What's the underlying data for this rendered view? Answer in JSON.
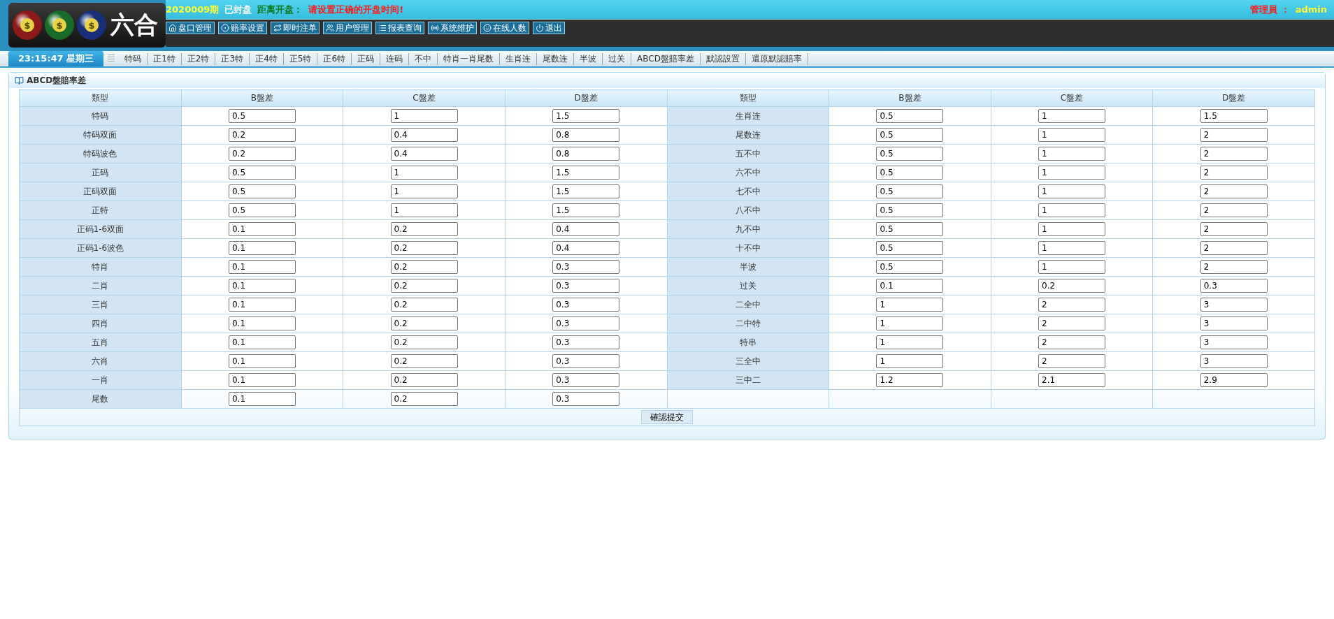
{
  "logo": {
    "balls": [
      {
        "color": "#8b1a1a",
        "symbol": "$"
      },
      {
        "color": "#1a6b2a",
        "symbol": "$"
      },
      {
        "color": "#1a2f7a",
        "symbol": "$"
      }
    ],
    "title": "六合"
  },
  "status": {
    "period": "2020009期",
    "state": "已封盘",
    "countdown_label": "距离开盘：",
    "countdown_value": "请设置正确的开盘时间!",
    "user_label": "管理員 ：",
    "user": "admin"
  },
  "nav": [
    {
      "kind": "home",
      "label": "盘口管理"
    },
    {
      "kind": "target",
      "label": "赔率设置"
    },
    {
      "kind": "repeat",
      "label": "即时注单"
    },
    {
      "kind": "users",
      "label": "用户管理"
    },
    {
      "kind": "list",
      "label": "报表查询"
    },
    {
      "kind": "signal",
      "label": "系统维护"
    },
    {
      "kind": "smile",
      "label": "在线人数"
    },
    {
      "kind": "power",
      "label": "退出"
    }
  ],
  "clock": "23:15:47 星期三",
  "tabs": [
    "特码",
    "正1特",
    "正2特",
    "正3特",
    "正4特",
    "正5特",
    "正6特",
    "正码",
    "连码",
    "不中",
    "特肖一肖尾数",
    "生肖连",
    "尾数连",
    "半波",
    "过关",
    "ABCD盤賠率差",
    "默認設置",
    "還原默認賠率"
  ],
  "panel": {
    "title": "ABCD盤賠率差",
    "columns": [
      "類型",
      "B盤差",
      "C盤差",
      "D盤差",
      "類型",
      "B盤差",
      "C盤差",
      "D盤差"
    ],
    "rows": [
      {
        "left": {
          "type": "特码",
          "b": "0.5",
          "c": "1",
          "d": "1.5"
        },
        "right": {
          "type": "生肖连",
          "b": "0.5",
          "c": "1",
          "d": "1.5"
        }
      },
      {
        "left": {
          "type": "特码双面",
          "b": "0.2",
          "c": "0.4",
          "d": "0.8"
        },
        "right": {
          "type": "尾数连",
          "b": "0.5",
          "c": "1",
          "d": "2"
        }
      },
      {
        "left": {
          "type": "特码波色",
          "b": "0.2",
          "c": "0.4",
          "d": "0.8"
        },
        "right": {
          "type": "五不中",
          "b": "0.5",
          "c": "1",
          "d": "2"
        }
      },
      {
        "left": {
          "type": "正码",
          "b": "0.5",
          "c": "1",
          "d": "1.5"
        },
        "right": {
          "type": "六不中",
          "b": "0.5",
          "c": "1",
          "d": "2"
        }
      },
      {
        "left": {
          "type": "正码双面",
          "b": "0.5",
          "c": "1",
          "d": "1.5"
        },
        "right": {
          "type": "七不中",
          "b": "0.5",
          "c": "1",
          "d": "2"
        }
      },
      {
        "left": {
          "type": "正特",
          "b": "0.5",
          "c": "1",
          "d": "1.5"
        },
        "right": {
          "type": "八不中",
          "b": "0.5",
          "c": "1",
          "d": "2"
        }
      },
      {
        "left": {
          "type": "正码1-6双面",
          "b": "0.1",
          "c": "0.2",
          "d": "0.4"
        },
        "right": {
          "type": "九不中",
          "b": "0.5",
          "c": "1",
          "d": "2"
        }
      },
      {
        "left": {
          "type": "正码1-6波色",
          "b": "0.1",
          "c": "0.2",
          "d": "0.4"
        },
        "right": {
          "type": "十不中",
          "b": "0.5",
          "c": "1",
          "d": "2"
        }
      },
      {
        "left": {
          "type": "特肖",
          "b": "0.1",
          "c": "0.2",
          "d": "0.3"
        },
        "right": {
          "type": "半波",
          "b": "0.5",
          "c": "1",
          "d": "2"
        }
      },
      {
        "left": {
          "type": "二肖",
          "b": "0.1",
          "c": "0.2",
          "d": "0.3"
        },
        "right": {
          "type": "过关",
          "b": "0.1",
          "c": "0.2",
          "d": "0.3"
        }
      },
      {
        "left": {
          "type": "三肖",
          "b": "0.1",
          "c": "0.2",
          "d": "0.3"
        },
        "right": {
          "type": "二全中",
          "b": "1",
          "c": "2",
          "d": "3"
        }
      },
      {
        "left": {
          "type": "四肖",
          "b": "0.1",
          "c": "0.2",
          "d": "0.3"
        },
        "right": {
          "type": "二中特",
          "b": "1",
          "c": "2",
          "d": "3"
        }
      },
      {
        "left": {
          "type": "五肖",
          "b": "0.1",
          "c": "0.2",
          "d": "0.3"
        },
        "right": {
          "type": "特串",
          "b": "1",
          "c": "2",
          "d": "3"
        }
      },
      {
        "left": {
          "type": "六肖",
          "b": "0.1",
          "c": "0.2",
          "d": "0.3"
        },
        "right": {
          "type": "三全中",
          "b": "1",
          "c": "2",
          "d": "3"
        }
      },
      {
        "left": {
          "type": "一肖",
          "b": "0.1",
          "c": "0.2",
          "d": "0.3"
        },
        "right": {
          "type": "三中二",
          "b": "1.2",
          "c": "2.1",
          "d": "2.9"
        }
      },
      {
        "left": {
          "type": "尾数",
          "b": "0.1",
          "c": "0.2",
          "d": "0.3"
        }
      }
    ],
    "submit": "確認提交"
  }
}
